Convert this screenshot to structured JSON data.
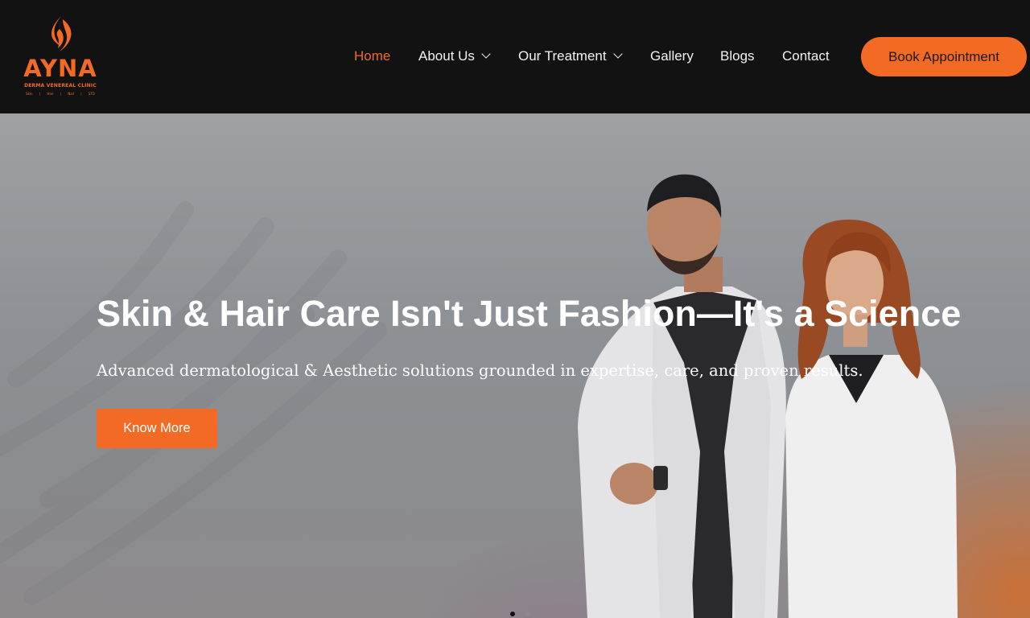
{
  "brand": {
    "name": "AYNA",
    "subtitle": "DERMA VENEREAL CLINIC",
    "tags": [
      "Skin",
      "|",
      "Hair",
      "|",
      "Nail",
      "|",
      "STD"
    ],
    "accent": "#f26a23"
  },
  "nav": {
    "items": [
      {
        "label": "Home",
        "active": true,
        "dropdown": false
      },
      {
        "label": "About Us",
        "active": false,
        "dropdown": true
      },
      {
        "label": "Our Treatment",
        "active": false,
        "dropdown": true
      },
      {
        "label": "Gallery",
        "active": false,
        "dropdown": false
      },
      {
        "label": "Blogs",
        "active": false,
        "dropdown": false
      },
      {
        "label": "Contact",
        "active": false,
        "dropdown": false
      }
    ],
    "cta_label": "Book Appointment"
  },
  "hero": {
    "title": "Skin & Hair Care Isn't Just Fashion—It's a Science",
    "subtitle": "Advanced dermatological & Aesthetic solutions grounded in expertise, care, and proven results.",
    "button_label": "Know More",
    "slides": 2,
    "active_slide": 1
  }
}
